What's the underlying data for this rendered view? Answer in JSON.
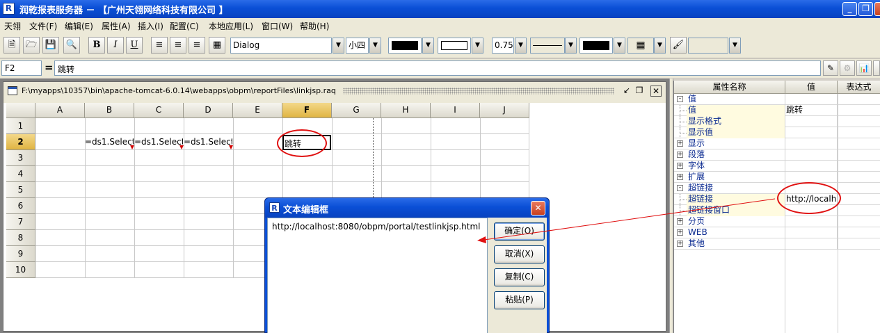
{
  "window": {
    "title": "润乾报表服务器 － 【广州天翎网络科技有限公司 】",
    "app_icon": "R",
    "min_glyph": "_",
    "max_glyph": "❐",
    "close_glyph": "✕"
  },
  "menu": [
    "天翎",
    "文件(F)",
    "编辑(E)",
    "属性(A)",
    "插入(I)",
    "配置(C)",
    "本地应用(L)",
    "窗口(W)",
    "帮助(H)"
  ],
  "toolbar": {
    "font_name": "Dialog",
    "font_size": "小四",
    "line_width": "0.75",
    "bold_label": "B",
    "italic_label": "I",
    "underline_label": "U",
    "colors": {
      "fore": "#000000",
      "back": "#ffffff",
      "border": "#000000"
    }
  },
  "formula_bar": {
    "cell_ref": "F2",
    "equals": "=",
    "content": "跳转"
  },
  "document": {
    "path": "F:\\myapps\\10357\\bin\\apache-tomcat-6.0.14\\webapps\\obpm\\reportFiles\\linkjsp.raq"
  },
  "grid": {
    "columns": [
      "A",
      "B",
      "C",
      "D",
      "E",
      "F",
      "G",
      "H",
      "I",
      "J"
    ],
    "rows": [
      "1",
      "2",
      "3",
      "4",
      "5",
      "6",
      "7",
      "8",
      "9",
      "10"
    ],
    "selected_column": "F",
    "selected_row": "2",
    "cells": {
      "B2": "=ds1.Select",
      "C2": "=ds1.Select",
      "D2": "=ds1.Select",
      "F2": "跳转"
    }
  },
  "dialog": {
    "title": "文本编辑框",
    "icon": "R",
    "text": "http://localhost:8080/obpm/portal/testlinkjsp.html",
    "buttons": {
      "ok": "确定(O)",
      "cancel": "取消(X)",
      "copy": "复制(C)",
      "paste": "粘贴(P)"
    }
  },
  "properties": {
    "headers": {
      "name": "属性名称",
      "value": "值",
      "expression": "表达式"
    },
    "rows": [
      {
        "name": "值",
        "value": "",
        "kind": "group-open"
      },
      {
        "name": "值",
        "value": "跳转",
        "kind": "child"
      },
      {
        "name": "显示格式",
        "value": "",
        "kind": "child"
      },
      {
        "name": "显示值",
        "value": "",
        "kind": "child"
      },
      {
        "name": "显示",
        "value": "",
        "kind": "group"
      },
      {
        "name": "段落",
        "value": "",
        "kind": "group"
      },
      {
        "name": "字体",
        "value": "",
        "kind": "group"
      },
      {
        "name": "扩展",
        "value": "",
        "kind": "group"
      },
      {
        "name": "超链接",
        "value": "",
        "kind": "group-open"
      },
      {
        "name": "超链接",
        "value": "http://localhost",
        "kind": "child"
      },
      {
        "name": "超链接窗口",
        "value": "",
        "kind": "child"
      },
      {
        "name": "分页",
        "value": "",
        "kind": "group"
      },
      {
        "name": "WEB",
        "value": "",
        "kind": "group"
      },
      {
        "name": "其他",
        "value": "",
        "kind": "group"
      }
    ]
  }
}
